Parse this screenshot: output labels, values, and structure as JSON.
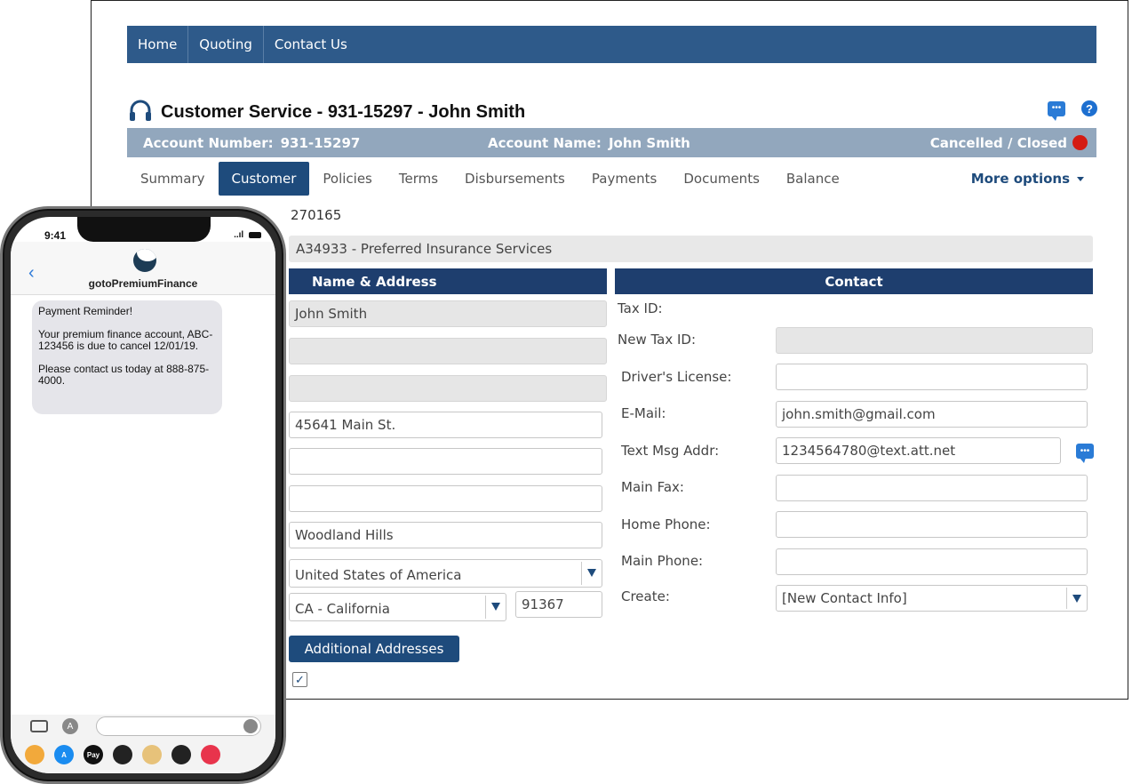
{
  "topnav": {
    "items": [
      "Home",
      "Quoting",
      "Contact Us"
    ]
  },
  "header": {
    "title": "Customer Service - 931-15297 - John Smith",
    "help_glyph": "?"
  },
  "account_bar": {
    "number_label": "Account Number:",
    "number_value": "931-15297",
    "name_label": "Account Name:",
    "name_value": "John Smith",
    "status": "Cancelled / Closed",
    "status_color": "#d41b12"
  },
  "tabs": {
    "items": [
      {
        "label": "Summary"
      },
      {
        "label": "Customer"
      },
      {
        "label": "Policies"
      },
      {
        "label": "Terms"
      },
      {
        "label": "Disbursements"
      },
      {
        "label": "Payments"
      },
      {
        "label": "Documents"
      },
      {
        "label": "Balance"
      }
    ],
    "active": "Customer",
    "more": "More options"
  },
  "customer": {
    "id": "270165",
    "agency": "A34933 - Preferred Insurance Services"
  },
  "name_address": {
    "heading": "Name & Address",
    "name": "John Smith",
    "address1": "45641 Main St.",
    "city": "Woodland Hills",
    "country": "United States of America",
    "state": "CA - California",
    "zip": "91367",
    "additional_button": "Additional Addresses",
    "check_glyph": "✓"
  },
  "contact": {
    "heading": "Contact",
    "tax_id_label": "Tax ID:",
    "new_tax_id_label": "New Tax ID:",
    "drivers_license_label": "Driver's License:",
    "email_label": "E-Mail:",
    "email_value": "john.smith@gmail.com",
    "text_msg_label": "Text Msg Addr:",
    "text_msg_value": "1234564780@text.att.net",
    "main_fax_label": "Main Fax:",
    "home_phone_label": "Home Phone:",
    "main_phone_label": "Main Phone:",
    "create_label": "Create:",
    "create_value": "[New Contact Info]"
  },
  "phone": {
    "time": "9:41",
    "signal": "..ıl",
    "contact_name": "gotoPremiumFinance",
    "back_glyph": "‹",
    "message": [
      "Payment Reminder!",
      "Your premium finance account, ABC-123456 is due to cancel 12/01/19.",
      "Please contact us today at 888-875-4000."
    ],
    "appstore_glyph": "A",
    "tray": [
      {
        "icon": "photos-icon",
        "glyph": "",
        "color": "#f2a93b"
      },
      {
        "icon": "appstore-icon",
        "glyph": "A",
        "color": "#1a8cf0"
      },
      {
        "icon": "applepay-icon",
        "glyph": "Pay",
        "color": "#111111"
      },
      {
        "icon": "activity-icon",
        "glyph": "",
        "color": "#222222"
      },
      {
        "icon": "memoji-icon",
        "glyph": "",
        "color": "#e7c27a"
      },
      {
        "icon": "heart-icon",
        "glyph": "",
        "color": "#222222"
      },
      {
        "icon": "search-icon",
        "glyph": "",
        "color": "#e8344c"
      }
    ]
  },
  "colors": {
    "nav": "#2e5a8a",
    "account_bar": "#92a7bd",
    "active_tab": "#1e4b7c",
    "section_head": "#1e3e6e"
  }
}
